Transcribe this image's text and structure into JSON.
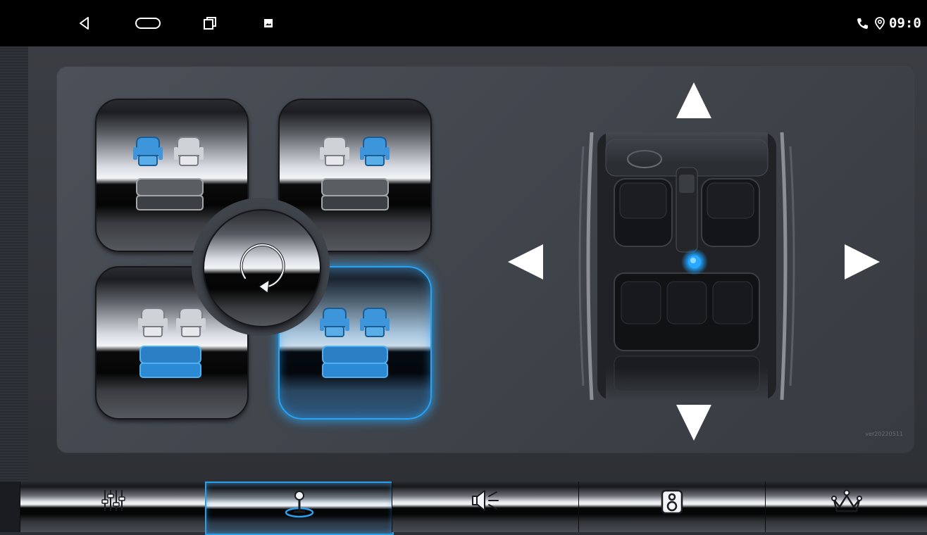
{
  "status_bar": {
    "nav_icons": [
      "back-icon",
      "home-icon",
      "recents-icon",
      "gallery-icon"
    ],
    "status_icons": [
      "phone-icon",
      "location-icon"
    ],
    "time": "09:0"
  },
  "seat_panel": {
    "modes": [
      {
        "name": "driver-seat",
        "highlight": "front-left",
        "active": false
      },
      {
        "name": "passenger-seat",
        "highlight": "front-right",
        "active": false
      },
      {
        "name": "rear-seats",
        "highlight": "rear",
        "active": false
      },
      {
        "name": "all-seats",
        "highlight": "all",
        "active": true
      }
    ],
    "reset_icon": "reset-rotate-icon"
  },
  "balance": {
    "arrows": [
      "arrow-up-icon",
      "arrow-left-icon",
      "arrow-right-icon",
      "arrow-down-icon"
    ],
    "sound_point_icon": "sound-focus-dot-icon",
    "version": "ver20220511"
  },
  "tabs": [
    {
      "icon": "equalizer-icon",
      "active": false
    },
    {
      "icon": "joystick-balance-icon",
      "active": true
    },
    {
      "icon": "speaker-volume-icon",
      "active": false
    },
    {
      "icon": "subwoofer-icon",
      "active": false
    },
    {
      "icon": "crown-effects-icon",
      "active": false
    }
  ],
  "colors": {
    "accent": "#2aa3f2",
    "seat_active": "#2e8fd6",
    "seat_inactive": "#c4c7cc",
    "panel": "#44484f",
    "status_bar": "#000000"
  }
}
